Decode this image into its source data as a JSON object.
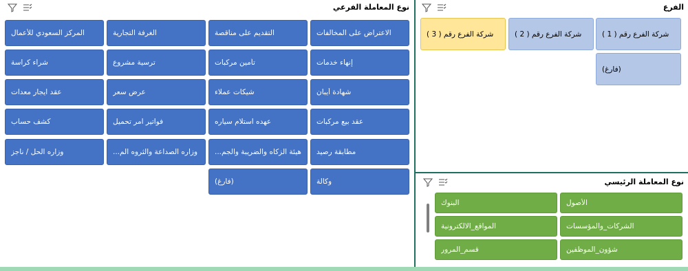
{
  "sub_type_panel": {
    "title": "نوع المعاملة الفرعي",
    "icons": [
      "filter-clear-icon",
      "multi-select-icon"
    ],
    "tiles": [
      [
        "الاعتراض على المخالفات",
        "التقديم على مناقصة",
        "الغرفة التجارية",
        "المركز السعودي للأعمال"
      ],
      [
        "إنهاء خدمات",
        "تأمين مركبات",
        "ترسية مشروع",
        "شراء كراسة"
      ],
      [
        "شهادة أيبان",
        "شيكات عملاء",
        "عرض سعر",
        "عقد ايجار معدات"
      ],
      [
        "عقد بيع مركبات",
        "عهده استلام سياره",
        "فواتير امر تحميل",
        "كشف حساب"
      ],
      [
        "مطابقة رصيد",
        "هيئة الزكاه والضريبة والجم...",
        "وزاره الصداعة والثروه الم...",
        "وزاره الحل / ناجز"
      ],
      [
        "وكالة",
        "(فارغ)"
      ]
    ]
  },
  "branch_panel": {
    "title": "الفرع",
    "icons": [
      "filter-clear-icon",
      "multi-select-icon"
    ],
    "tiles": [
      "شركة الفرع رقم ( 1 )",
      "شركة الفرع رقم ( 2 )",
      "شركة الفرع رقم ( 3 )",
      "(فارغ)"
    ],
    "selected_index": 2
  },
  "main_type_panel": {
    "title": "نوع المعاملة الرئيسي",
    "icons": [
      "filter-clear-icon",
      "multi-select-icon"
    ],
    "tiles": [
      "الأصول",
      "البنوك",
      "الشركات_والمؤسسات",
      "المواقع_الالكترونية",
      "شؤون_الموظفين",
      "قسم_المرور"
    ]
  },
  "colors": {
    "blue_tile": "#4472c4",
    "slicer_tile": "#b4c7e7",
    "selected_tile": "#ffe699",
    "green_tile": "#70ad47",
    "divider": "#1f6f5f"
  }
}
